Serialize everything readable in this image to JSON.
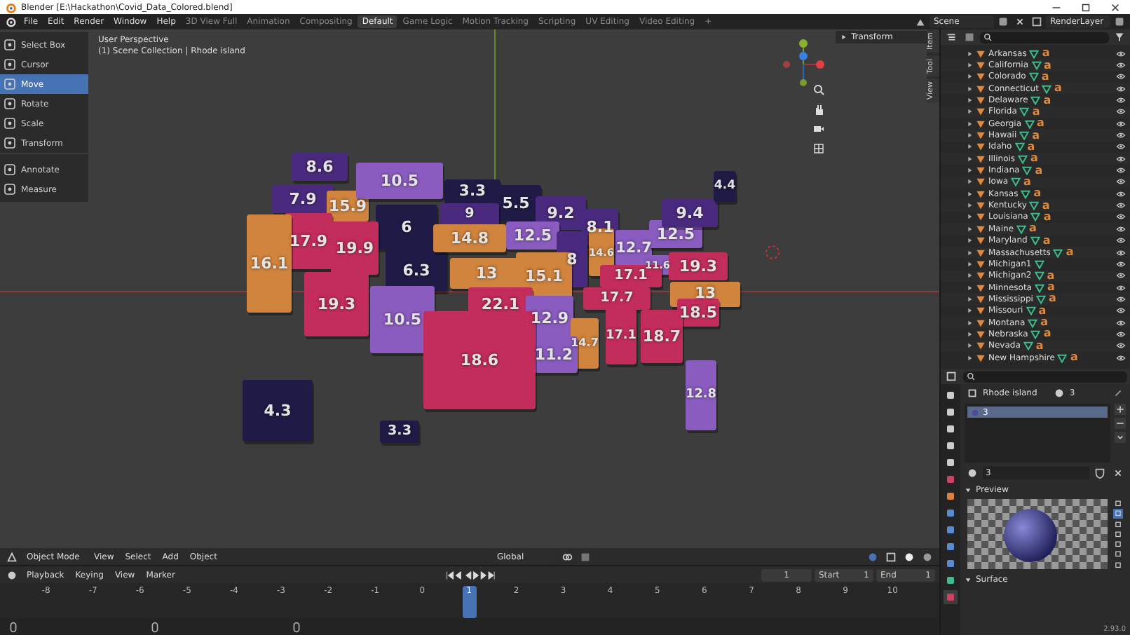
{
  "window": {
    "title": "Blender [E:\\Hackathon\\Covid_Data_Colored.blend]"
  },
  "menu": [
    "File",
    "Edit",
    "Render",
    "Window",
    "Help"
  ],
  "workspaces": [
    {
      "label": "3D View Full",
      "selected": false
    },
    {
      "label": "Animation",
      "selected": false
    },
    {
      "label": "Compositing",
      "selected": false
    },
    {
      "label": "Default",
      "selected": true
    },
    {
      "label": "Game Logic",
      "selected": false
    },
    {
      "label": "Motion Tracking",
      "selected": false
    },
    {
      "label": "Scripting",
      "selected": false
    },
    {
      "label": "UV Editing",
      "selected": false
    },
    {
      "label": "Video Editing",
      "selected": false
    }
  ],
  "add_workspace": "+",
  "scene": "Scene",
  "render_layer": "RenderLayer",
  "toolbar": [
    {
      "label": "Select Box",
      "selected": false
    },
    {
      "label": "Cursor",
      "selected": false
    },
    {
      "label": "Move",
      "selected": true
    },
    {
      "label": "Rotate",
      "selected": false
    },
    {
      "label": "Scale",
      "selected": false
    },
    {
      "label": "Transform",
      "selected": false
    },
    {
      "label": "Annotate",
      "selected": false
    },
    {
      "label": "Measure",
      "selected": false
    }
  ],
  "viewport": {
    "perspective": "User Perspective",
    "collection": "(1) Scene Collection | Rhode island",
    "sidebar_panel": "Transform",
    "sidebar_tabs": [
      "Item",
      "Tool",
      "View"
    ]
  },
  "map": [
    {
      "value": "8.6",
      "color": "#4a2a7e"
    },
    {
      "value": "7.9",
      "color": "#4a2a7e"
    },
    {
      "value": "15.9",
      "color": "#d0843e"
    },
    {
      "value": "10.5",
      "color": "#8a5cbf"
    },
    {
      "value": "3.3",
      "color": "#1f1b46"
    },
    {
      "value": "5.5",
      "color": "#1f1b46"
    },
    {
      "value": "9",
      "color": "#4a2a7e"
    },
    {
      "value": "9.2",
      "color": "#4a2a7e"
    },
    {
      "value": "6",
      "color": "#1f1b46"
    },
    {
      "value": "17.9",
      "color": "#c22d5c"
    },
    {
      "value": "19.9",
      "color": "#c22d5c"
    },
    {
      "value": "16.1",
      "color": "#d0843e"
    },
    {
      "value": "6.3",
      "color": "#1f1b46"
    },
    {
      "value": "14.8",
      "color": "#d0843e"
    },
    {
      "value": "12.5",
      "color": "#8a5cbf"
    },
    {
      "value": "8.1",
      "color": "#4a2a7e"
    },
    {
      "value": "8",
      "color": "#4a2a7e"
    },
    {
      "value": "14.6",
      "color": "#d0843e"
    },
    {
      "value": "12.7",
      "color": "#8a5cbf"
    },
    {
      "value": "12.5",
      "color": "#8a5cbf"
    },
    {
      "value": "9.4",
      "color": "#4a2a7e"
    },
    {
      "value": "4.4",
      "color": "#1f1b46"
    },
    {
      "value": "13",
      "color": "#d0843e"
    },
    {
      "value": "15.1",
      "color": "#d0843e"
    },
    {
      "value": "11.6",
      "color": "#8a5cbf"
    },
    {
      "value": "19.3",
      "color": "#c22d5c"
    },
    {
      "value": "17.1",
      "color": "#c22d5c"
    },
    {
      "value": "19.3",
      "color": "#c22d5c"
    },
    {
      "value": "22.1",
      "color": "#c22d5c"
    },
    {
      "value": "17.7",
      "color": "#c22d5c"
    },
    {
      "value": "13",
      "color": "#d0843e"
    },
    {
      "value": "10.5",
      "color": "#8a5cbf"
    },
    {
      "value": "12.9",
      "color": "#8a5cbf"
    },
    {
      "value": "18.5",
      "color": "#c22d5c"
    },
    {
      "value": "14.7",
      "color": "#d0843e"
    },
    {
      "value": "17.1",
      "color": "#c22d5c"
    },
    {
      "value": "18.7",
      "color": "#c22d5c"
    },
    {
      "value": "11.2",
      "color": "#8a5cbf"
    },
    {
      "value": "18.6",
      "color": "#c22d5c"
    },
    {
      "value": "12.8",
      "color": "#8a5cbf"
    },
    {
      "value": "4.3",
      "color": "#1f1b46"
    },
    {
      "value": "3.3",
      "color": "#1f1b46"
    }
  ],
  "viewport_header": {
    "mode": "Object Mode",
    "menus": [
      "View",
      "Select",
      "Add",
      "Object"
    ],
    "orientation": "Global"
  },
  "timeline": {
    "menus": [
      "Playback",
      "Keying",
      "View",
      "Marker"
    ],
    "current_frame": "1",
    "start_label": "Start",
    "start": "1",
    "end_label": "End",
    "end": "1",
    "ticks": [
      {
        "label": "-8",
        "selected": false
      },
      {
        "label": "-7",
        "selected": false
      },
      {
        "label": "-6",
        "selected": false
      },
      {
        "label": "-5",
        "selected": false
      },
      {
        "label": "-4",
        "selected": false
      },
      {
        "label": "-3",
        "selected": false
      },
      {
        "label": "-2",
        "selected": false
      },
      {
        "label": "-1",
        "selected": false
      },
      {
        "label": "0",
        "selected": false
      },
      {
        "label": "1",
        "selected": true
      },
      {
        "label": "2",
        "selected": false
      },
      {
        "label": "3",
        "selected": false
      },
      {
        "label": "4",
        "selected": false
      },
      {
        "label": "5",
        "selected": false
      },
      {
        "label": "6",
        "selected": false
      },
      {
        "label": "7",
        "selected": false
      },
      {
        "label": "8",
        "selected": false
      },
      {
        "label": "9",
        "selected": false
      },
      {
        "label": "10",
        "selected": false
      }
    ]
  },
  "outliner": [
    {
      "name": "Arkansas",
      "data_icon": "a"
    },
    {
      "name": "California",
      "data_icon": "a"
    },
    {
      "name": "Colorado",
      "data_icon": "a"
    },
    {
      "name": "Connecticut",
      "data_icon": "a"
    },
    {
      "name": "Delaware",
      "data_icon": "a"
    },
    {
      "name": "Florida",
      "data_icon": "a"
    },
    {
      "name": "Georgia",
      "data_icon": "a"
    },
    {
      "name": "Hawaii",
      "data_icon": "a"
    },
    {
      "name": "Idaho",
      "data_icon": "a"
    },
    {
      "name": "Illinois",
      "data_icon": "a"
    },
    {
      "name": "Indiana",
      "data_icon": "a"
    },
    {
      "name": "Iowa",
      "data_icon": "a"
    },
    {
      "name": "Kansas",
      "data_icon": "a"
    },
    {
      "name": "Kentucky",
      "data_icon": "a"
    },
    {
      "name": "Louisiana",
      "data_icon": "a"
    },
    {
      "name": "Maine",
      "data_icon": "a"
    },
    {
      "name": "Maryland",
      "data_icon": "a"
    },
    {
      "name": "Massachusetts",
      "data_icon": "a"
    },
    {
      "name": "Michigan1"
    },
    {
      "name": "Michigan2",
      "data_icon": "a"
    },
    {
      "name": "Minnesota",
      "data_icon": "a"
    },
    {
      "name": "Mississippi",
      "data_icon": "a"
    },
    {
      "name": "Missouri",
      "data_icon": "a"
    },
    {
      "name": "Montana",
      "data_icon": "a"
    },
    {
      "name": "Nebraska",
      "data_icon": "a"
    },
    {
      "name": "Nevada",
      "data_icon": "a"
    },
    {
      "name": "New Hampshire",
      "data_icon": "a"
    }
  ],
  "properties": {
    "object": "Rhode island",
    "material_users": "3",
    "slots": [
      {
        "name": "3",
        "selected": true
      }
    ],
    "material": "3",
    "sections": [
      "Preview",
      "Surface"
    ]
  },
  "version": "2.93.0"
}
